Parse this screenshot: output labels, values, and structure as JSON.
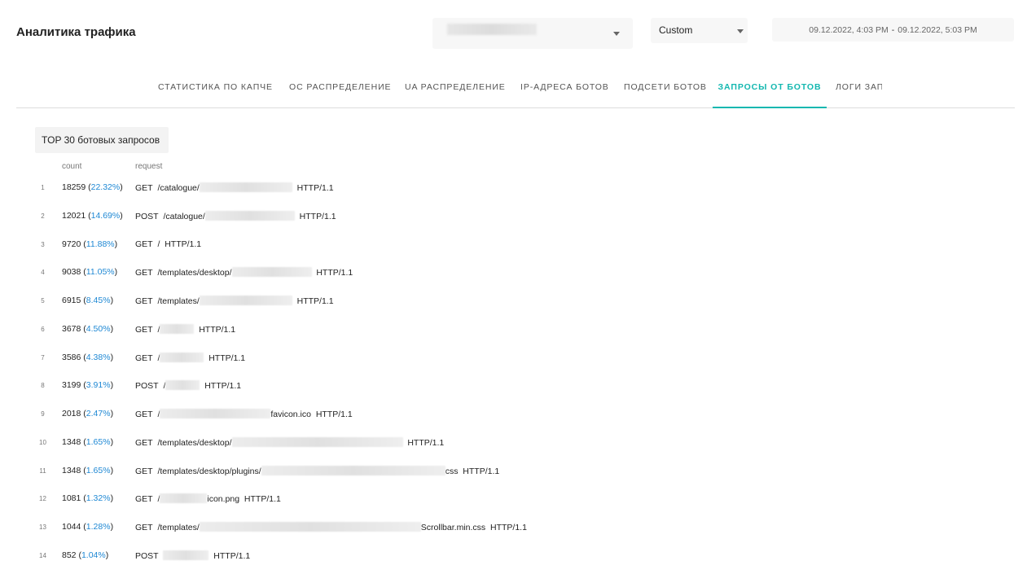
{
  "header": {
    "title": "Аналитика трафика",
    "period": "Custom",
    "date_from": "09.12.2022, 4:03 PM",
    "date_sep": "-",
    "date_to": "09.12.2022, 5:03 PM"
  },
  "tabs": [
    {
      "label": "СТАТИСТИКА ПО КАПЧЕ",
      "active": false
    },
    {
      "label": "ОС РАСПРЕДЕЛЕНИЕ",
      "active": false
    },
    {
      "label": "UA РАСПРЕДЕЛЕНИЕ",
      "active": false
    },
    {
      "label": "IP-АДРЕСА БОТОВ",
      "active": false
    },
    {
      "label": "ПОДСЕТИ БОТОВ",
      "active": false
    },
    {
      "label": "ЗАПРОСЫ ОТ БОТОВ",
      "active": true
    },
    {
      "label": "ЛОГИ ЗАП",
      "active": false
    }
  ],
  "table": {
    "title": "TOP 30 ботовых запросов",
    "col_count": "count",
    "col_request": "request",
    "rows": [
      {
        "idx": "1",
        "count": "18259",
        "pct": "22.32%",
        "method": "GET",
        "prefix": "/catalogue/",
        "suffix": "HTTP/1.1"
      },
      {
        "idx": "2",
        "count": "12021",
        "pct": "14.69%",
        "method": "POST",
        "prefix": "/catalogue/",
        "suffix": "HTTP/1.1"
      },
      {
        "idx": "3",
        "count": "9720",
        "pct": "11.88%",
        "method": "GET",
        "prefix": "/",
        "suffix": "HTTP/1.1"
      },
      {
        "idx": "4",
        "count": "9038",
        "pct": "11.05%",
        "method": "GET",
        "prefix": "/templates/desktop/",
        "suffix": "HTTP/1.1"
      },
      {
        "idx": "5",
        "count": "6915",
        "pct": "8.45%",
        "method": "GET",
        "prefix": "/templates/",
        "suffix": "HTTP/1.1"
      },
      {
        "idx": "6",
        "count": "3678",
        "pct": "4.50%",
        "method": "GET",
        "prefix": "/",
        "suffix": "HTTP/1.1"
      },
      {
        "idx": "7",
        "count": "3586",
        "pct": "4.38%",
        "method": "GET",
        "prefix": "/",
        "suffix": "HTTP/1.1"
      },
      {
        "idx": "8",
        "count": "3199",
        "pct": "3.91%",
        "method": "POST",
        "prefix": "/",
        "suffix": "HTTP/1.1"
      },
      {
        "idx": "9",
        "count": "2018",
        "pct": "2.47%",
        "method": "GET",
        "prefix": "/",
        "tail": "favicon.ico",
        "suffix": "HTTP/1.1"
      },
      {
        "idx": "10",
        "count": "1348",
        "pct": "1.65%",
        "method": "GET",
        "prefix": "/templates/desktop/",
        "suffix": "HTTP/1.1"
      },
      {
        "idx": "11",
        "count": "1348",
        "pct": "1.65%",
        "method": "GET",
        "prefix": "/templates/desktop/plugins/",
        "tail": "css",
        "suffix": "HTTP/1.1"
      },
      {
        "idx": "12",
        "count": "1081",
        "pct": "1.32%",
        "method": "GET",
        "prefix": "/",
        "tail": "icon.png",
        "suffix": "HTTP/1.1"
      },
      {
        "idx": "13",
        "count": "1044",
        "pct": "1.28%",
        "method": "GET",
        "prefix": "/templates/",
        "tail": "Scrollbar.min.css",
        "suffix": "HTTP/1.1"
      },
      {
        "idx": "14",
        "count": "852",
        "pct": "1.04%",
        "method": "POST",
        "prefix": "",
        "suffix": "HTTP/1.1"
      }
    ]
  },
  "colors": {
    "accent": "#14b8b0",
    "link": "#1e88d4"
  }
}
